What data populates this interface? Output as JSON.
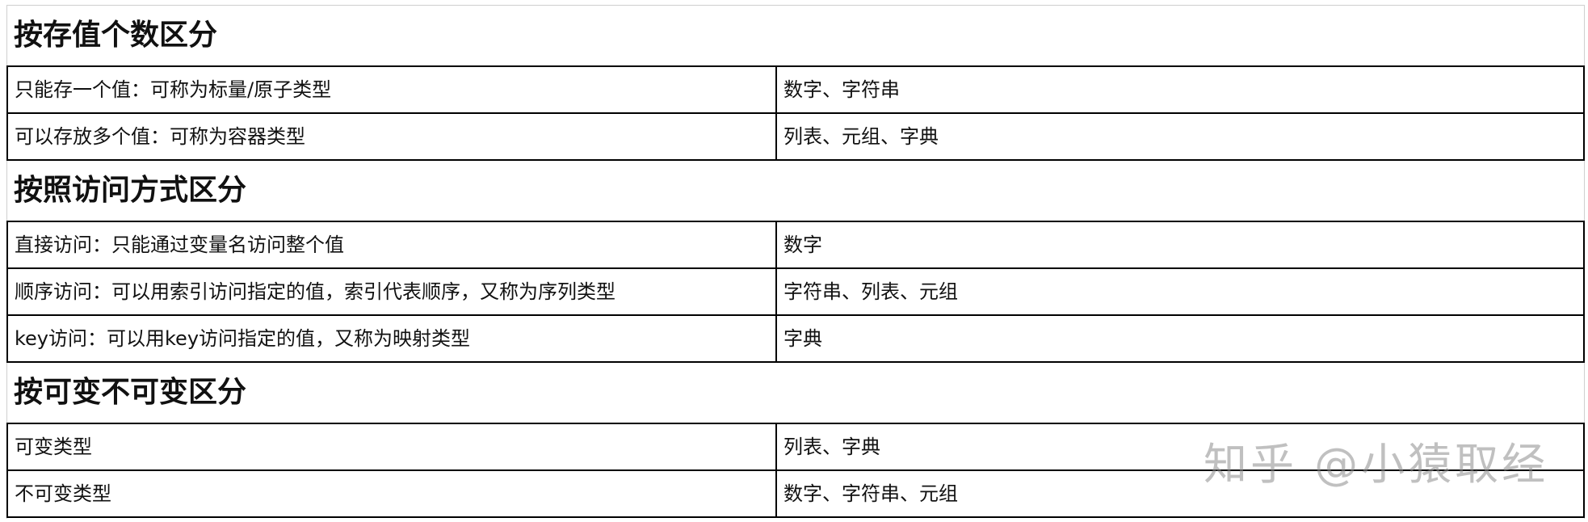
{
  "sections": [
    {
      "title": "按存值个数区分",
      "rows": [
        {
          "desc": "只能存一个值：可称为标量/原子类型",
          "value": "数字、字符串"
        },
        {
          "desc": "可以存放多个值：可称为容器类型",
          "value": "列表、元组、字典"
        }
      ]
    },
    {
      "title": "按照访问方式区分",
      "rows": [
        {
          "desc": "直接访问：只能通过变量名访问整个值",
          "value": "数字"
        },
        {
          "desc": "顺序访问：可以用索引访问指定的值，索引代表顺序，又称为序列类型",
          "value": "字符串、列表、元组"
        },
        {
          "desc": "key访问：可以用key访问指定的值，又称为映射类型",
          "value": "字典"
        }
      ]
    },
    {
      "title": "按可变不可变区分",
      "rows": [
        {
          "desc": "可变类型",
          "value": "列表、字典"
        },
        {
          "desc": "不可变类型",
          "value": "数字、字符串、元组"
        }
      ]
    }
  ],
  "watermark": "知乎 @小猿取经"
}
